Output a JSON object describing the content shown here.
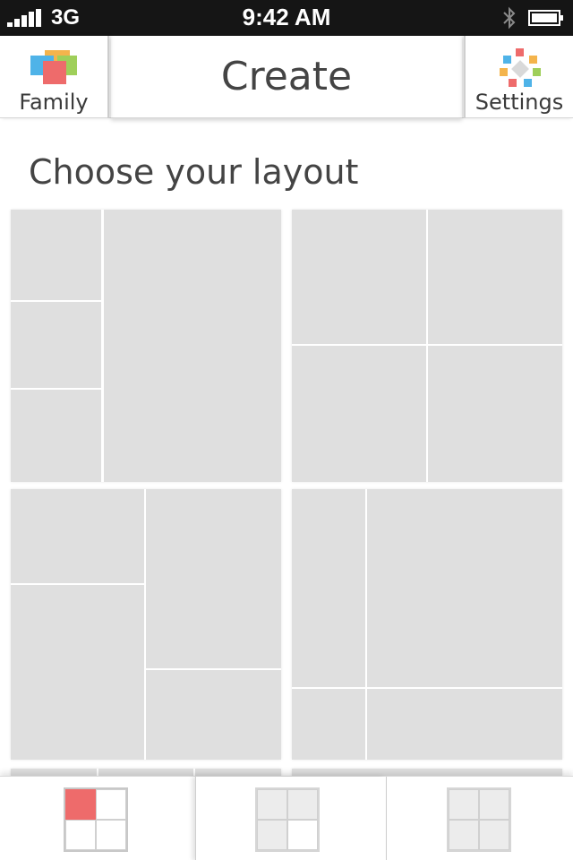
{
  "status_bar": {
    "network": "3G",
    "time": "9:42 AM"
  },
  "header": {
    "left_button_label": "Family",
    "title": "Create",
    "right_button_label": "Settings"
  },
  "main": {
    "section_title": "Choose your layout",
    "layouts": [
      {
        "id": "layout-1",
        "description_icon": "layout-three-left-one-big-right"
      },
      {
        "id": "layout-2",
        "description_icon": "layout-four-quadrants"
      },
      {
        "id": "layout-3",
        "description_icon": "layout-two-columns-staggered"
      },
      {
        "id": "layout-4",
        "description_icon": "layout-big-top-right-split-bottom"
      }
    ]
  },
  "tab_bar": {
    "tabs": [
      {
        "name": "layout-tab-1",
        "icon": "grid-layout-icon",
        "selected": true,
        "accent": "#ee6b6b"
      },
      {
        "name": "layout-tab-2",
        "icon": "grid-layout-icon",
        "selected": false
      },
      {
        "name": "layout-tab-3",
        "icon": "grid-layout-icon",
        "selected": false
      }
    ]
  },
  "colors": {
    "status_bar_bg": "#151515",
    "cell_gray": "#dfdfdf",
    "text": "#444444",
    "accent_red": "#ee6b6b"
  }
}
